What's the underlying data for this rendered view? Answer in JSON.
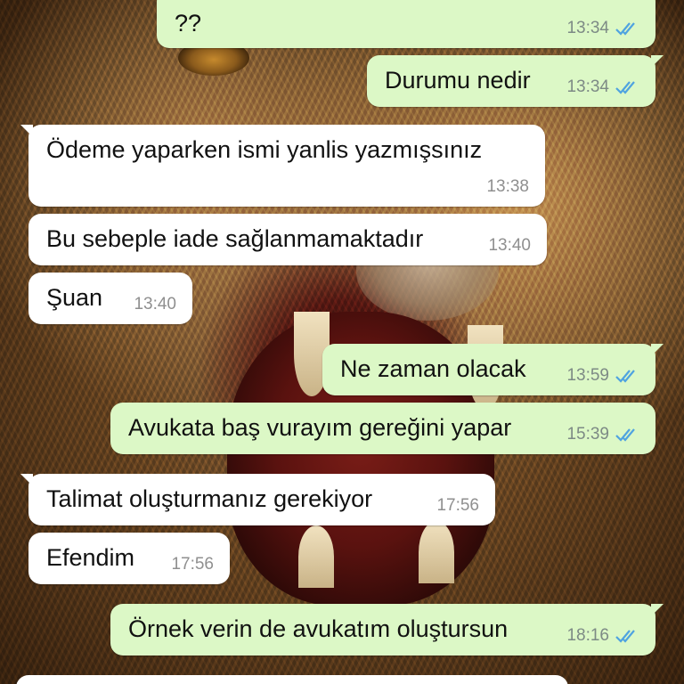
{
  "colors": {
    "outgoing_bubble": "#dcf8c6",
    "incoming_bubble": "#ffffff",
    "read_tick": "#4fa3e0"
  },
  "wallpaper": {
    "description_icon": "lion-wallpaper-image"
  },
  "messages": [
    {
      "direction": "out",
      "text": "??",
      "time": "13:34",
      "status": "read-double-tick"
    },
    {
      "direction": "out",
      "text": "Durumu nedir",
      "time": "13:34",
      "status": "read-double-tick"
    },
    {
      "direction": "in",
      "text": "Ödeme yaparken ismi yanlis yazmışsınız",
      "time": "13:38"
    },
    {
      "direction": "in",
      "text": "Bu sebeple iade sağlanmamaktadır",
      "time": "13:40"
    },
    {
      "direction": "in",
      "text": "Şuan",
      "time": "13:40"
    },
    {
      "direction": "out",
      "text": "Ne zaman olacak",
      "time": "13:59",
      "status": "read-double-tick"
    },
    {
      "direction": "out",
      "text": "Avukata baş vurayım gereğini yapar",
      "time": "15:39",
      "status": "read-double-tick"
    },
    {
      "direction": "in",
      "text": "Talimat oluşturmanız gerekiyor",
      "time": "17:56"
    },
    {
      "direction": "in",
      "text": "Efendim",
      "time": "17:56"
    },
    {
      "direction": "out",
      "text": "Örnek verin de avukatım oluştursun",
      "time": "18:16",
      "status": "read-double-tick"
    }
  ]
}
